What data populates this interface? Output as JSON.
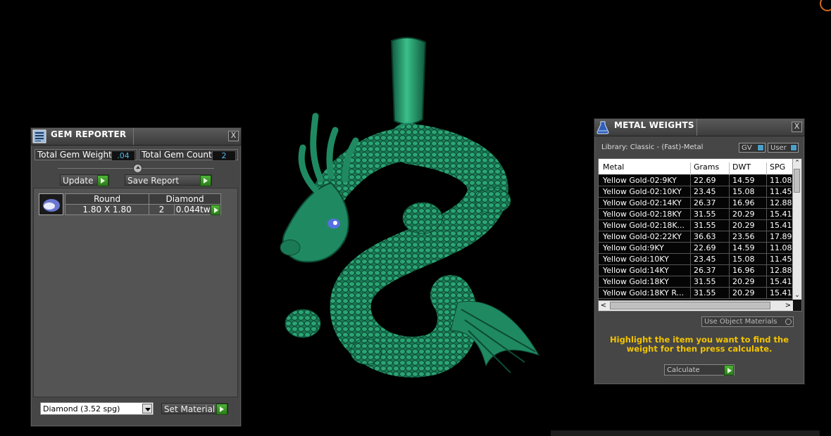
{
  "gem_reporter": {
    "title": "GEM REPORTER",
    "close_label": "X",
    "total_weight_label": "Total Gem Weight",
    "total_weight_value": ".04",
    "total_count_label": "Total Gem Count",
    "total_count_value": "2",
    "update_label": "Update",
    "save_report_label": "Save Report",
    "columns": [
      "Round",
      "Diamond"
    ],
    "gem": {
      "size": "1.80 X 1.80",
      "count": "2",
      "weight": "0.044tw"
    },
    "material_select": "Diamond    (3.52 spg)",
    "set_material_label": "Set Material"
  },
  "metal_weights": {
    "title": "METAL WEIGHTS",
    "close_label": "X",
    "library_label": "Library: Classic - (Fast)-Metal",
    "gv_label": "GV",
    "user_label": "User",
    "columns": [
      "Metal",
      "Grams",
      "DWT",
      "SPG"
    ],
    "rows": [
      [
        "Yellow Gold-02:9KY",
        "22.69",
        "14.59",
        "11.08"
      ],
      [
        "Yellow Gold-02:10KY",
        "23.45",
        "15.08",
        "11.45"
      ],
      [
        "Yellow Gold-02:14KY",
        "26.37",
        "16.96",
        "12.88"
      ],
      [
        "Yellow Gold-02:18KY",
        "31.55",
        "20.29",
        "15.41"
      ],
      [
        "Yellow Gold-02:18K...",
        "31.55",
        "20.29",
        "15.41"
      ],
      [
        "Yellow Gold-02:22KY",
        "36.63",
        "23.56",
        "17.89"
      ],
      [
        "Yellow Gold:9KY",
        "22.69",
        "14.59",
        "11.08"
      ],
      [
        "Yellow Gold:10KY",
        "23.45",
        "15.08",
        "11.45"
      ],
      [
        "Yellow Gold:14KY",
        "26.37",
        "16.96",
        "12.88"
      ],
      [
        "Yellow Gold:18KY",
        "31.55",
        "20.29",
        "15.41"
      ],
      [
        "Yellow Gold:18KY R...",
        "31.55",
        "20.29",
        "15.41"
      ]
    ],
    "use_object_materials": "Use Object Materials",
    "hint": "Highlight the item you want to find the weight for then press calculate.",
    "calculate_label": "Calculate"
  },
  "colors": {
    "model": "#1f8a62",
    "hint": "#f2c400",
    "value_text": "#4fb6e6"
  }
}
